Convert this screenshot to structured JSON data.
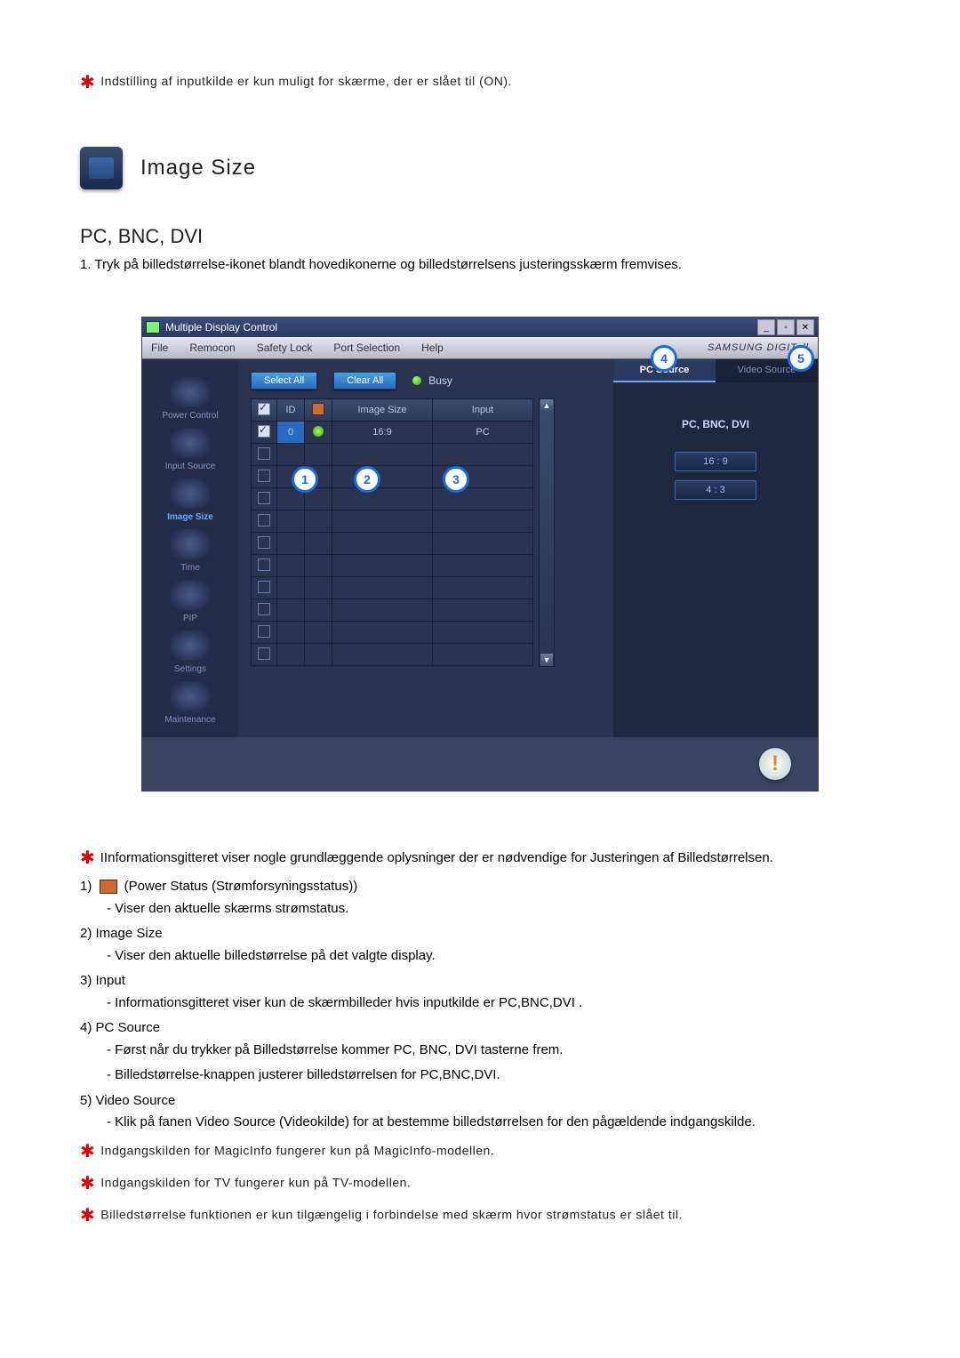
{
  "intro_note": "Indstilling af inputkilde er kun muligt for skærme, der er slået til (ON).",
  "section_title": "Image Size",
  "subheading": "PC, BNC, DVI",
  "step_1": "1.  Tryk på billedstørrelse-ikonet blandt hovedikonerne og billedstørrelsens justeringsskærm fremvises.",
  "window": {
    "title": "Multiple Display Control",
    "menus": [
      "File",
      "Remocon",
      "Safety Lock",
      "Port Selection",
      "Help"
    ],
    "brand": "SAMSUNG DIGITall",
    "sidebar": [
      {
        "label": "Power Control",
        "active": false
      },
      {
        "label": "Input Source",
        "active": false
      },
      {
        "label": "Image Size",
        "active": true
      },
      {
        "label": "Time",
        "active": false
      },
      {
        "label": "PIP",
        "active": false
      },
      {
        "label": "Settings",
        "active": false
      },
      {
        "label": "Maintenance",
        "active": false
      }
    ],
    "buttons": {
      "select_all": "Select All",
      "clear_all": "Clear All",
      "busy": "Busy"
    },
    "grid": {
      "headers": {
        "chk": "",
        "id": "ID",
        "pwr": "",
        "size": "Image Size",
        "input": "Input"
      },
      "rows": [
        {
          "chk": true,
          "id": "0",
          "pwr": true,
          "size": "16:9",
          "input": "PC"
        },
        {
          "chk": false,
          "id": "",
          "pwr": false,
          "size": "",
          "input": ""
        },
        {
          "chk": false,
          "id": "",
          "pwr": false,
          "size": "",
          "input": ""
        },
        {
          "chk": false,
          "id": "",
          "pwr": false,
          "size": "",
          "input": ""
        },
        {
          "chk": false,
          "id": "",
          "pwr": false,
          "size": "",
          "input": ""
        },
        {
          "chk": false,
          "id": "",
          "pwr": false,
          "size": "",
          "input": ""
        },
        {
          "chk": false,
          "id": "",
          "pwr": false,
          "size": "",
          "input": ""
        },
        {
          "chk": false,
          "id": "",
          "pwr": false,
          "size": "",
          "input": ""
        },
        {
          "chk": false,
          "id": "",
          "pwr": false,
          "size": "",
          "input": ""
        },
        {
          "chk": false,
          "id": "",
          "pwr": false,
          "size": "",
          "input": ""
        },
        {
          "chk": false,
          "id": "",
          "pwr": false,
          "size": "",
          "input": ""
        }
      ]
    },
    "callouts": {
      "c1": "1",
      "c2": "2",
      "c3": "3",
      "c4": "4",
      "c5": "5"
    },
    "right": {
      "tab_pc": "PC Source",
      "tab_video": "Video Source",
      "label": "PC, BNC, DVI",
      "btn_169": "16 : 9",
      "btn_43": "4 : 3"
    }
  },
  "notes": {
    "info_grid": "IInformationsgitteret viser nogle grundlæggende oplysninger der er nødvendige for Justeringen af Billedstørrelsen.",
    "n1_head": "1) ",
    "n1_after": " (Power Status (Strømforsyningsstatus))",
    "n1_sub": "- Viser den aktuelle skærms strømstatus.",
    "n2_head": "2)  Image Size",
    "n2_sub": "- Viser den aktuelle billedstørrelse på det valgte display.",
    "n3_head": "3)  Input",
    "n3_sub": "- Informationsgitteret viser kun de skærmbilleder hvis inputkilde er PC,BNC,DVI .",
    "n4_head": "4)  PC Source",
    "n4_sub1": "- Først når du trykker på Billedstørrelse kommer PC, BNC, DVI tasterne frem.",
    "n4_sub2": "- Billedstørrelse-knappen justerer billedstørrelsen for PC,BNC,DVI.",
    "n5_head": "5)  Video Source",
    "n5_sub": "- Klik på fanen Video Source (Videokilde) for at bestemme billedstørrelsen for den pågældende indgangskilde.",
    "star1": "Indgangskilden for MagicInfo fungerer kun på MagicInfo-modellen.",
    "star2": "Indgangskilden for TV fungerer kun på TV-modellen.",
    "star3": "Billedstørrelse funktionen er kun tilgængelig i forbindelse med skærm hvor strømstatus er slået til."
  }
}
